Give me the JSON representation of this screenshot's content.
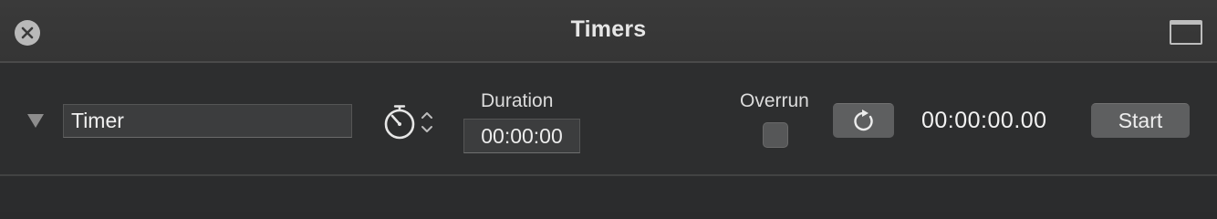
{
  "window": {
    "title": "Timers"
  },
  "icons": {
    "close": "close-icon",
    "window_toggle": "window-icon",
    "disclosure": "disclosure-triangle-icon",
    "timer_mode": "stopwatch-icon",
    "timer_mode_stepper": "up-down-chevron-icon",
    "reset": "reset-icon"
  },
  "timer": {
    "name": "Timer",
    "duration_label": "Duration",
    "duration_value": "00:00:00",
    "overrun_label": "Overrun",
    "overrun_checked": false,
    "time_display": "00:00:00.00",
    "start_label": "Start"
  },
  "colors": {
    "background": "#2b2c2d",
    "titlebar": "#383838",
    "button": "#5e5f60",
    "text": "#e8e8e8"
  }
}
